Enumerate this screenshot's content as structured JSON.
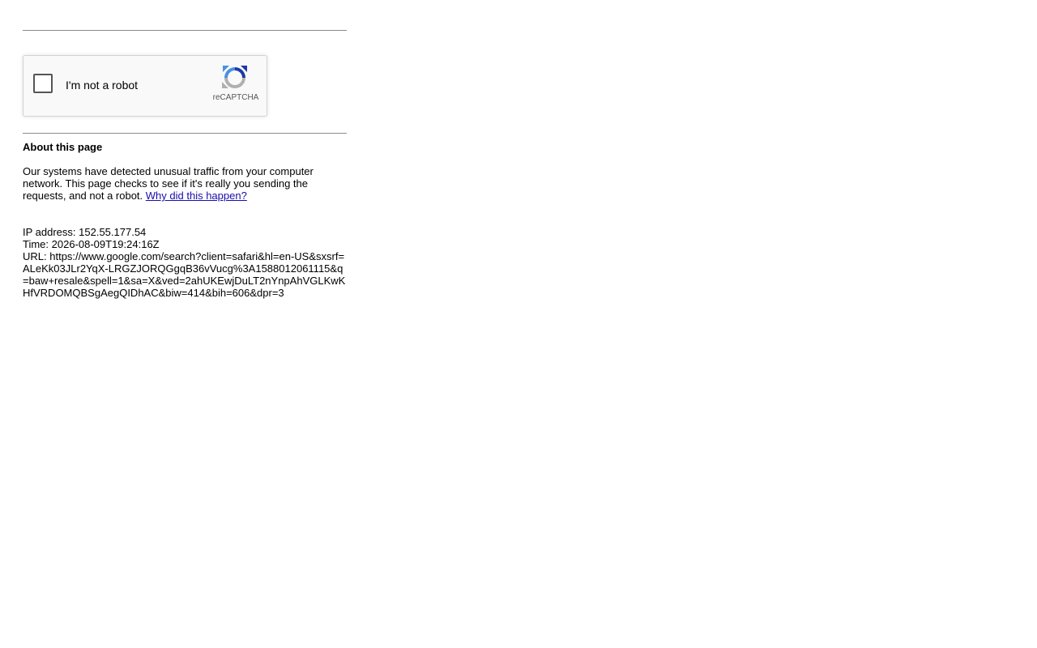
{
  "captcha": {
    "label": "I'm not a robot",
    "brand": "reCAPTCHA",
    "checked": false,
    "icon": "recaptcha-logo-icon"
  },
  "about": {
    "title": "About this page",
    "text": "Our systems have detected unusual traffic from your computer network. This page checks to see if it's really you sending the requests, and not a robot. ",
    "link_label": "Why did this happen?"
  },
  "meta": {
    "ip_label": "IP address: ",
    "ip": "152.55.177.54",
    "time_label": "Time: ",
    "time": "2026-08-09T19:24:16Z",
    "url_label": "URL: ",
    "url": "https://www.google.com/search?client=safari&hl=en-US&sxsrf=ALeKk03JLr2YqX-LRGZJORQGgqB36vVucg%3A1588012061115&q=baw+resale&spell=1&sa=X&ved=2ahUKEwjDuLT2nYnpAhVGLKwKHfVRDOMQBSgAegQIDhAC&biw=414&bih=606&dpr=3"
  },
  "colors": {
    "link": "#1a0dab",
    "recaptcha_blue": "#1c3aa9",
    "recaptcha_lightblue": "#4a90e2",
    "recaptcha_gray": "#b0b0b0"
  }
}
